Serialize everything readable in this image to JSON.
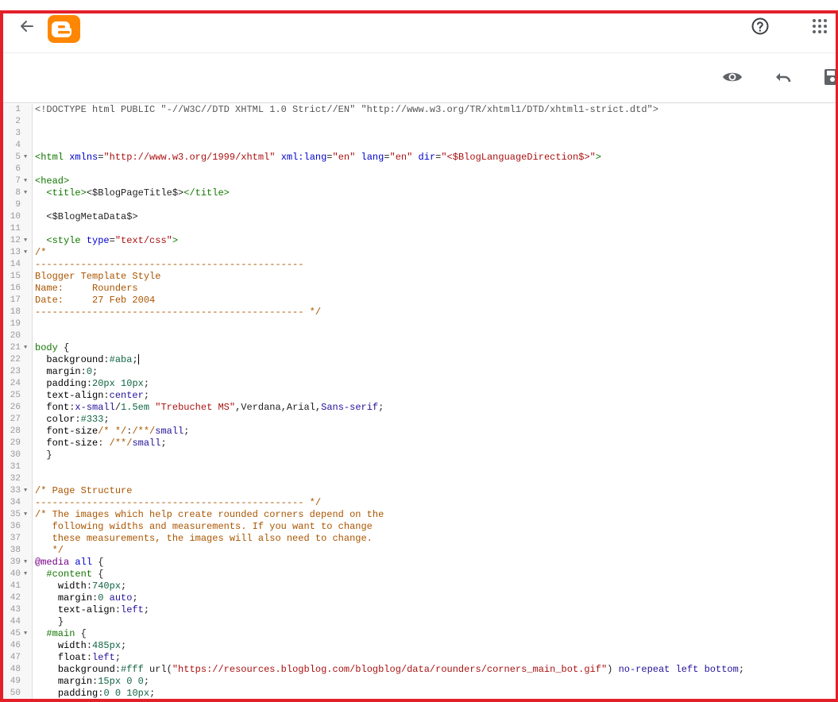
{
  "header": {
    "back_icon": "arrow-back-icon",
    "logo": "blogger-logo",
    "help_icon": "help-circle-icon",
    "apps_icon": "apps-grid-icon",
    "accent_color": "#ff8600",
    "frame_color": "#e3202a"
  },
  "toolbar": {
    "preview_icon": "eye-icon",
    "undo_icon": "undo-icon",
    "save_icon": "save-icon"
  },
  "editor": {
    "cursor_line": 22,
    "lines": [
      {
        "n": "1",
        "fold": false,
        "indent": "",
        "tokens": [
          {
            "c": "meta",
            "t": "<!DOCTYPE html PUBLIC \"-//W3C//DTD XHTML 1.0 Strict//EN\" \"http://www.w3.org/TR/xhtml1/DTD/xhtml1-strict.dtd\">"
          }
        ]
      },
      {
        "n": "2",
        "fold": false,
        "indent": "",
        "tokens": []
      },
      {
        "n": "3",
        "fold": false,
        "indent": "",
        "tokens": []
      },
      {
        "n": "4",
        "fold": false,
        "indent": "",
        "tokens": []
      },
      {
        "n": "5",
        "fold": true,
        "indent": "",
        "tokens": [
          {
            "c": "tag",
            "t": "<html"
          },
          {
            "c": "",
            "t": " "
          },
          {
            "c": "attr",
            "t": "xmlns"
          },
          {
            "c": "",
            "t": "="
          },
          {
            "c": "str",
            "t": "\"http://www.w3.org/1999/xhtml\""
          },
          {
            "c": "",
            "t": " "
          },
          {
            "c": "attr",
            "t": "xml:lang"
          },
          {
            "c": "",
            "t": "="
          },
          {
            "c": "str",
            "t": "\"en\""
          },
          {
            "c": "",
            "t": " "
          },
          {
            "c": "attr",
            "t": "lang"
          },
          {
            "c": "",
            "t": "="
          },
          {
            "c": "str",
            "t": "\"en\""
          },
          {
            "c": "",
            "t": " "
          },
          {
            "c": "attr",
            "t": "dir"
          },
          {
            "c": "",
            "t": "="
          },
          {
            "c": "str",
            "t": "\"<$BlogLanguageDirection$>\""
          },
          {
            "c": "tag",
            "t": ">"
          }
        ]
      },
      {
        "n": "6",
        "fold": false,
        "indent": "",
        "tokens": []
      },
      {
        "n": "7",
        "fold": true,
        "indent": "",
        "tokens": [
          {
            "c": "tag",
            "t": "<head>"
          }
        ]
      },
      {
        "n": "8",
        "fold": true,
        "indent": "  ",
        "tokens": [
          {
            "c": "tag",
            "t": "<title>"
          },
          {
            "c": "",
            "t": "<$BlogPageTitle$>"
          },
          {
            "c": "tag",
            "t": "</title>"
          }
        ]
      },
      {
        "n": "9",
        "fold": false,
        "indent": "",
        "tokens": []
      },
      {
        "n": "10",
        "fold": false,
        "indent": "  ",
        "tokens": [
          {
            "c": "",
            "t": "<$BlogMetaData$>"
          }
        ]
      },
      {
        "n": "11",
        "fold": false,
        "indent": "",
        "tokens": []
      },
      {
        "n": "12",
        "fold": true,
        "indent": "  ",
        "tokens": [
          {
            "c": "tag",
            "t": "<style"
          },
          {
            "c": "",
            "t": " "
          },
          {
            "c": "attr",
            "t": "type"
          },
          {
            "c": "",
            "t": "="
          },
          {
            "c": "str",
            "t": "\"text/css\""
          },
          {
            "c": "tag",
            "t": ">"
          }
        ]
      },
      {
        "n": "13",
        "fold": true,
        "indent": "",
        "tokens": [
          {
            "c": "com",
            "t": "/*"
          }
        ]
      },
      {
        "n": "14",
        "fold": false,
        "indent": "",
        "tokens": [
          {
            "c": "com",
            "t": "-----------------------------------------------"
          }
        ]
      },
      {
        "n": "15",
        "fold": false,
        "indent": "",
        "tokens": [
          {
            "c": "com",
            "t": "Blogger Template Style"
          }
        ]
      },
      {
        "n": "16",
        "fold": false,
        "indent": "",
        "tokens": [
          {
            "c": "com",
            "t": "Name:     Rounders"
          }
        ]
      },
      {
        "n": "17",
        "fold": false,
        "indent": "",
        "tokens": [
          {
            "c": "com",
            "t": "Date:     27 Feb 2004"
          }
        ]
      },
      {
        "n": "18",
        "fold": false,
        "indent": "",
        "tokens": [
          {
            "c": "com",
            "t": "----------------------------------------------- */"
          }
        ]
      },
      {
        "n": "19",
        "fold": false,
        "indent": "",
        "tokens": []
      },
      {
        "n": "20",
        "fold": false,
        "indent": "",
        "tokens": []
      },
      {
        "n": "21",
        "fold": true,
        "indent": "",
        "tokens": [
          {
            "c": "tag",
            "t": "body"
          },
          {
            "c": "",
            "t": " {"
          }
        ]
      },
      {
        "n": "22",
        "fold": false,
        "indent": "  ",
        "tokens": [
          {
            "c": "prop",
            "t": "background"
          },
          {
            "c": "",
            "t": ":"
          },
          {
            "c": "num",
            "t": "#aba"
          },
          {
            "c": "",
            "t": ";"
          }
        ]
      },
      {
        "n": "23",
        "fold": false,
        "indent": "  ",
        "tokens": [
          {
            "c": "prop",
            "t": "margin"
          },
          {
            "c": "",
            "t": ":"
          },
          {
            "c": "num",
            "t": "0"
          },
          {
            "c": "",
            "t": ";"
          }
        ]
      },
      {
        "n": "24",
        "fold": false,
        "indent": "  ",
        "tokens": [
          {
            "c": "prop",
            "t": "padding"
          },
          {
            "c": "",
            "t": ":"
          },
          {
            "c": "num",
            "t": "20px"
          },
          {
            "c": "",
            "t": " "
          },
          {
            "c": "num",
            "t": "10px"
          },
          {
            "c": "",
            "t": ";"
          }
        ]
      },
      {
        "n": "25",
        "fold": false,
        "indent": "  ",
        "tokens": [
          {
            "c": "prop",
            "t": "text-align"
          },
          {
            "c": "",
            "t": ":"
          },
          {
            "c": "atom",
            "t": "center"
          },
          {
            "c": "",
            "t": ";"
          }
        ]
      },
      {
        "n": "26",
        "fold": false,
        "indent": "  ",
        "tokens": [
          {
            "c": "prop",
            "t": "font"
          },
          {
            "c": "",
            "t": ":"
          },
          {
            "c": "atom",
            "t": "x-small"
          },
          {
            "c": "",
            "t": "/"
          },
          {
            "c": "num",
            "t": "1.5em"
          },
          {
            "c": "",
            "t": " "
          },
          {
            "c": "str",
            "t": "\"Trebuchet MS\""
          },
          {
            "c": "",
            "t": ",Verdana,Arial,"
          },
          {
            "c": "atom",
            "t": "Sans-serif"
          },
          {
            "c": "",
            "t": ";"
          }
        ]
      },
      {
        "n": "27",
        "fold": false,
        "indent": "  ",
        "tokens": [
          {
            "c": "prop",
            "t": "color"
          },
          {
            "c": "",
            "t": ":"
          },
          {
            "c": "num",
            "t": "#333"
          },
          {
            "c": "",
            "t": ";"
          }
        ]
      },
      {
        "n": "28",
        "fold": false,
        "indent": "  ",
        "tokens": [
          {
            "c": "prop",
            "t": "font-size"
          },
          {
            "c": "",
            "t": ""
          },
          {
            "c": "com",
            "t": "/* */"
          },
          {
            "c": "",
            "t": ":"
          },
          {
            "c": "com",
            "t": "/**/"
          },
          {
            "c": "atom",
            "t": "small"
          },
          {
            "c": "",
            "t": ";"
          }
        ]
      },
      {
        "n": "29",
        "fold": false,
        "indent": "  ",
        "tokens": [
          {
            "c": "prop",
            "t": "font-size"
          },
          {
            "c": "",
            "t": ": "
          },
          {
            "c": "com",
            "t": "/**/"
          },
          {
            "c": "atom",
            "t": "small"
          },
          {
            "c": "",
            "t": ";"
          }
        ]
      },
      {
        "n": "30",
        "fold": false,
        "indent": "  ",
        "tokens": [
          {
            "c": "",
            "t": "}"
          }
        ]
      },
      {
        "n": "31",
        "fold": false,
        "indent": "",
        "tokens": []
      },
      {
        "n": "32",
        "fold": false,
        "indent": "",
        "tokens": []
      },
      {
        "n": "33",
        "fold": true,
        "indent": "",
        "tokens": [
          {
            "c": "com",
            "t": "/* Page Structure"
          }
        ]
      },
      {
        "n": "34",
        "fold": false,
        "indent": "",
        "tokens": [
          {
            "c": "com",
            "t": "----------------------------------------------- */"
          }
        ]
      },
      {
        "n": "35",
        "fold": true,
        "indent": "",
        "tokens": [
          {
            "c": "com",
            "t": "/* The images which help create rounded corners depend on the"
          }
        ]
      },
      {
        "n": "36",
        "fold": false,
        "indent": "   ",
        "tokens": [
          {
            "c": "com",
            "t": "following widths and measurements. If you want to change"
          }
        ]
      },
      {
        "n": "37",
        "fold": false,
        "indent": "   ",
        "tokens": [
          {
            "c": "com",
            "t": "these measurements, the images will also need to change."
          }
        ]
      },
      {
        "n": "38",
        "fold": false,
        "indent": "   ",
        "tokens": [
          {
            "c": "com",
            "t": "*/"
          }
        ]
      },
      {
        "n": "39",
        "fold": true,
        "indent": "",
        "tokens": [
          {
            "c": "kw",
            "t": "@media"
          },
          {
            "c": "",
            "t": " "
          },
          {
            "c": "attr",
            "t": "all"
          },
          {
            "c": "",
            "t": " {"
          }
        ]
      },
      {
        "n": "40",
        "fold": true,
        "indent": "  ",
        "tokens": [
          {
            "c": "tag",
            "t": "#content"
          },
          {
            "c": "",
            "t": " {"
          }
        ]
      },
      {
        "n": "41",
        "fold": false,
        "indent": "    ",
        "tokens": [
          {
            "c": "prop",
            "t": "width"
          },
          {
            "c": "",
            "t": ":"
          },
          {
            "c": "num",
            "t": "740px"
          },
          {
            "c": "",
            "t": ";"
          }
        ]
      },
      {
        "n": "42",
        "fold": false,
        "indent": "    ",
        "tokens": [
          {
            "c": "prop",
            "t": "margin"
          },
          {
            "c": "",
            "t": ":"
          },
          {
            "c": "num",
            "t": "0"
          },
          {
            "c": "",
            "t": " "
          },
          {
            "c": "atom",
            "t": "auto"
          },
          {
            "c": "",
            "t": ";"
          }
        ]
      },
      {
        "n": "43",
        "fold": false,
        "indent": "    ",
        "tokens": [
          {
            "c": "prop",
            "t": "text-align"
          },
          {
            "c": "",
            "t": ":"
          },
          {
            "c": "atom",
            "t": "left"
          },
          {
            "c": "",
            "t": ";"
          }
        ]
      },
      {
        "n": "44",
        "fold": false,
        "indent": "    ",
        "tokens": [
          {
            "c": "",
            "t": "}"
          }
        ]
      },
      {
        "n": "45",
        "fold": true,
        "indent": "  ",
        "tokens": [
          {
            "c": "tag",
            "t": "#main"
          },
          {
            "c": "",
            "t": " {"
          }
        ]
      },
      {
        "n": "46",
        "fold": false,
        "indent": "    ",
        "tokens": [
          {
            "c": "prop",
            "t": "width"
          },
          {
            "c": "",
            "t": ":"
          },
          {
            "c": "num",
            "t": "485px"
          },
          {
            "c": "",
            "t": ";"
          }
        ]
      },
      {
        "n": "47",
        "fold": false,
        "indent": "    ",
        "tokens": [
          {
            "c": "prop",
            "t": "float"
          },
          {
            "c": "",
            "t": ":"
          },
          {
            "c": "atom",
            "t": "left"
          },
          {
            "c": "",
            "t": ";"
          }
        ]
      },
      {
        "n": "48",
        "fold": false,
        "indent": "    ",
        "tokens": [
          {
            "c": "prop",
            "t": "background"
          },
          {
            "c": "",
            "t": ":"
          },
          {
            "c": "num",
            "t": "#fff"
          },
          {
            "c": "",
            "t": " url("
          },
          {
            "c": "str",
            "t": "\"https://resources.blogblog.com/blogblog/data/rounders/corners_main_bot.gif\""
          },
          {
            "c": "",
            "t": ") "
          },
          {
            "c": "atom",
            "t": "no-repeat"
          },
          {
            "c": "",
            "t": " "
          },
          {
            "c": "atom",
            "t": "left"
          },
          {
            "c": "",
            "t": " "
          },
          {
            "c": "atom",
            "t": "bottom"
          },
          {
            "c": "",
            "t": ";"
          }
        ]
      },
      {
        "n": "49",
        "fold": false,
        "indent": "    ",
        "tokens": [
          {
            "c": "prop",
            "t": "margin"
          },
          {
            "c": "",
            "t": ":"
          },
          {
            "c": "num",
            "t": "15px"
          },
          {
            "c": "",
            "t": " "
          },
          {
            "c": "num",
            "t": "0"
          },
          {
            "c": "",
            "t": " "
          },
          {
            "c": "num",
            "t": "0"
          },
          {
            "c": "",
            "t": ";"
          }
        ]
      },
      {
        "n": "50",
        "fold": false,
        "indent": "    ",
        "tokens": [
          {
            "c": "prop",
            "t": "padding"
          },
          {
            "c": "",
            "t": ":"
          },
          {
            "c": "num",
            "t": "0"
          },
          {
            "c": "",
            "t": " "
          },
          {
            "c": "num",
            "t": "0"
          },
          {
            "c": "",
            "t": " "
          },
          {
            "c": "num",
            "t": "10px"
          },
          {
            "c": "",
            "t": ";"
          }
        ]
      }
    ]
  }
}
